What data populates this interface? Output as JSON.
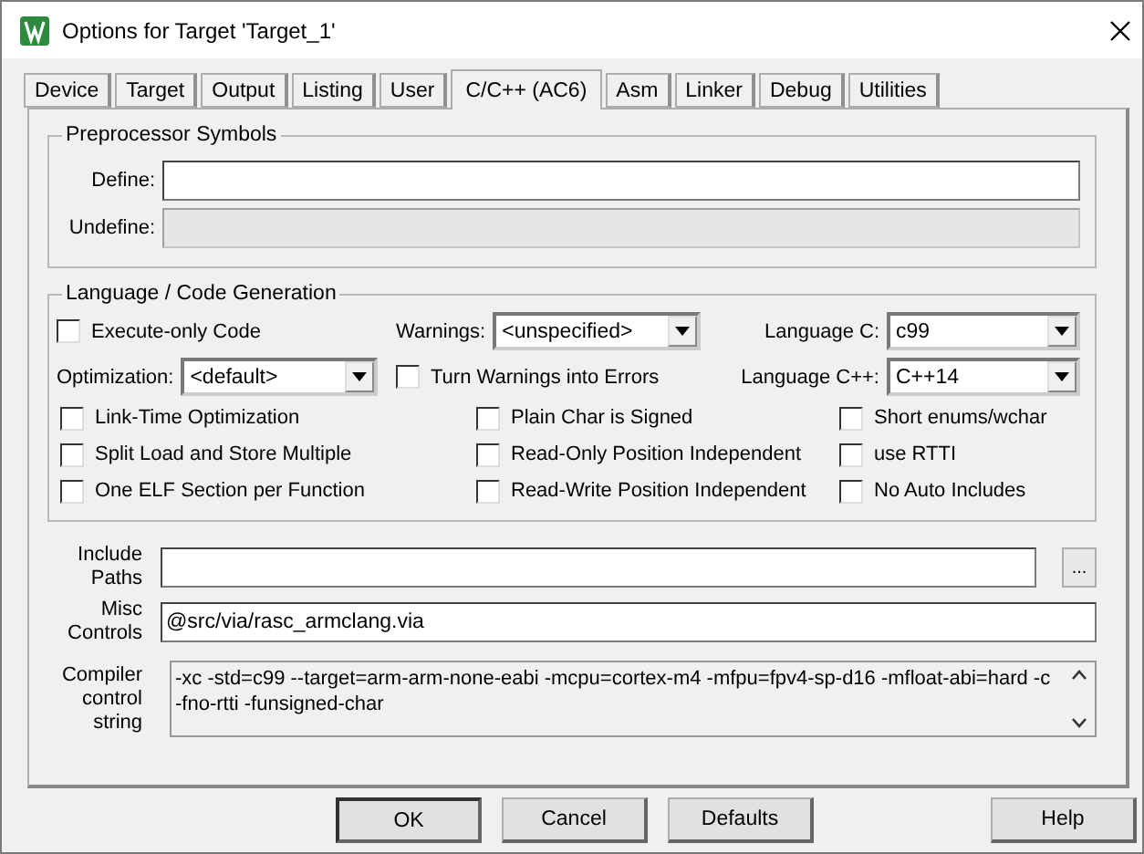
{
  "window": {
    "title": "Options for Target 'Target_1'"
  },
  "tabs": [
    {
      "label": "Device",
      "selected": false
    },
    {
      "label": "Target",
      "selected": false
    },
    {
      "label": "Output",
      "selected": false
    },
    {
      "label": "Listing",
      "selected": false
    },
    {
      "label": "User",
      "selected": false
    },
    {
      "label": "C/C++ (AC6)",
      "selected": true
    },
    {
      "label": "Asm",
      "selected": false
    },
    {
      "label": "Linker",
      "selected": false
    },
    {
      "label": "Debug",
      "selected": false
    },
    {
      "label": "Utilities",
      "selected": false
    }
  ],
  "preprocessor": {
    "title": "Preprocessor Symbols",
    "fields": [
      {
        "label": "Define:",
        "disabled": false
      },
      {
        "label": "Undefine:",
        "disabled": true
      }
    ]
  },
  "language": {
    "title": "Language / Code Generation",
    "rows": [
      [
        {
          "kind": "checkbox",
          "label": "Execute-only Code",
          "checked": false
        },
        {
          "kind": "select",
          "label": "Warnings:",
          "value": "<unspecified>"
        },
        {
          "kind": "select",
          "label": "Language C:",
          "value": "c99"
        }
      ],
      [
        {
          "kind": "select",
          "label": "Optimization:",
          "value": "<default>"
        },
        {
          "kind": "checkbox",
          "label": "Turn Warnings into Errors",
          "checked": false
        },
        {
          "kind": "select",
          "label": "Language C++:",
          "value": "C++14"
        }
      ],
      [
        {
          "kind": "checkbox",
          "label": "Link-Time Optimization",
          "checked": false
        },
        {
          "kind": "checkbox",
          "label": "Plain Char is Signed",
          "checked": false
        },
        {
          "kind": "checkbox",
          "label": "Short enums/wchar",
          "checked": false
        }
      ],
      [
        {
          "kind": "checkbox",
          "label": "Split Load and Store Multiple",
          "checked": false
        },
        {
          "kind": "checkbox",
          "label": "Read-Only Position Independent",
          "checked": false
        },
        {
          "kind": "checkbox",
          "label": "use RTTI",
          "checked": false
        }
      ],
      [
        {
          "kind": "checkbox",
          "label": "One ELF Section per Function",
          "checked": false
        },
        {
          "kind": "checkbox",
          "label": "Read-Write Position Independent",
          "checked": false
        },
        {
          "kind": "checkbox",
          "label": "No Auto Includes",
          "checked": false
        }
      ]
    ]
  },
  "include_paths": {
    "label": "Include Paths",
    "browse": "..."
  },
  "misc_controls": {
    "label": "Misc Controls",
    "value": "@src/via/rasc_armclang.via"
  },
  "compiler_string": {
    "label": "Compiler control string",
    "lines": [
      "-xc -std=c99 --target=arm-arm-none-eabi -mcpu=cortex-m4 -mfpu=fpv4-sp-d16 -mfloat-abi=hard -c",
      "-fno-rtti -funsigned-char"
    ]
  },
  "buttons": [
    {
      "label": "OK",
      "default": true
    },
    {
      "label": "Cancel",
      "default": false
    },
    {
      "label": "Defaults",
      "default": false
    },
    {
      "label": "Help",
      "default": false
    }
  ]
}
